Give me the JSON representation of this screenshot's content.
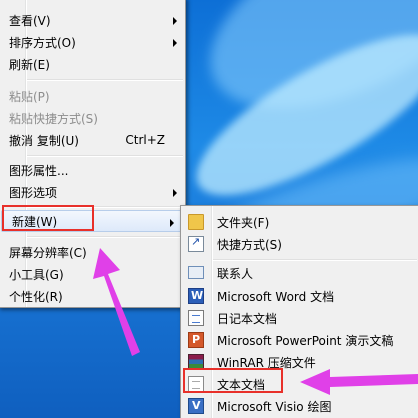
{
  "context_menu": {
    "items": [
      {
        "label": "查看(V)",
        "submenu": true,
        "disabled": false
      },
      {
        "label": "排序方式(O)",
        "submenu": true,
        "disabled": false
      },
      {
        "label": "刷新(E)",
        "submenu": false,
        "disabled": false
      },
      {
        "label": "粘贴(P)",
        "submenu": false,
        "disabled": true
      },
      {
        "label": "粘贴快捷方式(S)",
        "submenu": false,
        "disabled": true
      },
      {
        "label": "撤消 复制(U)",
        "shortcut": "Ctrl+Z",
        "submenu": false,
        "disabled": false
      },
      {
        "label": "图形属性...",
        "submenu": false,
        "disabled": false
      },
      {
        "label": "图形选项",
        "submenu": true,
        "disabled": false
      },
      {
        "label": "新建(W)",
        "submenu": true,
        "disabled": false,
        "highlighted": true
      },
      {
        "label": "屏幕分辨率(C)",
        "submenu": false,
        "disabled": false
      },
      {
        "label": "小工具(G)",
        "submenu": false,
        "disabled": false
      },
      {
        "label": "个性化(R)",
        "submenu": false,
        "disabled": false
      }
    ]
  },
  "new_submenu": {
    "items": [
      {
        "label": "文件夹(F)",
        "icon": "folder-icon"
      },
      {
        "label": "快捷方式(S)",
        "icon": "shortcut-icon"
      },
      {
        "label": "联系人",
        "icon": "contact-icon"
      },
      {
        "label": "Microsoft Word 文档",
        "icon": "word-icon"
      },
      {
        "label": "日记本文档",
        "icon": "journal-icon"
      },
      {
        "label": "Microsoft PowerPoint 演示文稿",
        "icon": "powerpoint-icon"
      },
      {
        "label": "WinRAR 压缩文件",
        "icon": "winrar-icon"
      },
      {
        "label": "文本文档",
        "icon": "text-document-icon",
        "highlighted": true
      },
      {
        "label": "Microsoft Visio 绘图",
        "icon": "visio-icon"
      }
    ]
  },
  "colors": {
    "highlight_box": "#e8302a",
    "annotation_arrow": "#e040e8",
    "menu_bg": "#f0f0f0",
    "desktop": "#1a78d8"
  }
}
